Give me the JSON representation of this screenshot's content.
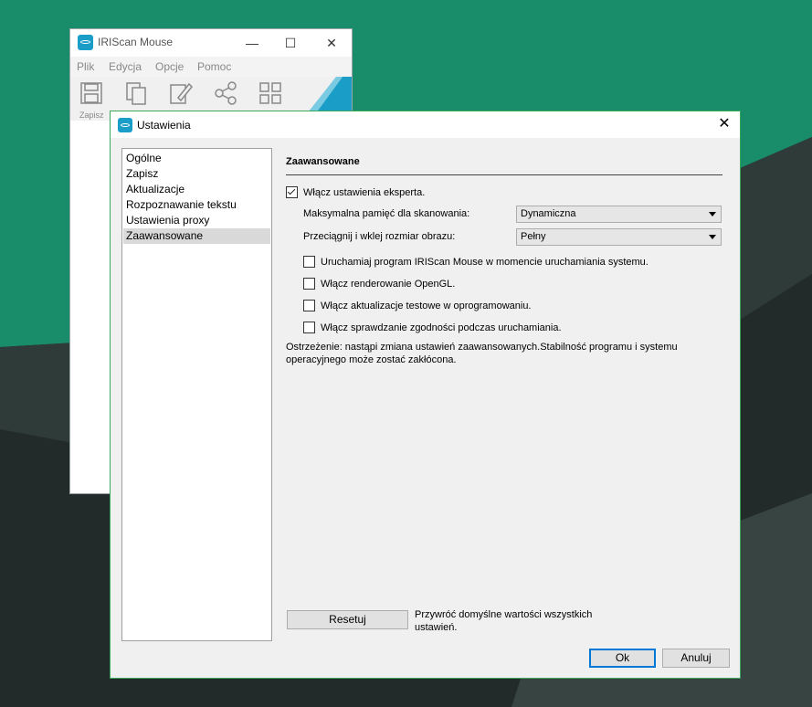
{
  "colors": {
    "desktop_teal": "#198c6a",
    "desktop_dark": "#27302f",
    "accent_blue": "#1a9ec8",
    "dialog_border": "#3aa85a"
  },
  "app_window": {
    "title": "IRIScan Mouse",
    "controls": {
      "minimize": "—",
      "maximize": "☐",
      "close": "✕"
    },
    "menu": [
      "Plik",
      "Edycja",
      "Opcje",
      "Pomoc"
    ],
    "toolbar": {
      "save_label": "Zapisz",
      "icons": [
        "save-icon",
        "copy-icon",
        "edit-icon",
        "share-icon",
        "grid-icon"
      ]
    }
  },
  "dialog": {
    "title": "Ustawienia",
    "close": "✕",
    "nav": [
      "Ogólne",
      "Zapisz",
      "Aktualizacje",
      "Rozpoznawanie tekstu",
      "Ustawienia proxy",
      "Zaawansowane"
    ],
    "selected_nav": "Zaawansowane",
    "section_title": "Zaawansowane",
    "expert_checkbox": {
      "label": "Włącz ustawienia eksperta.",
      "checked": true
    },
    "max_memory": {
      "label": "Maksymalna pamięć dla skanowania:",
      "value": "Dynamiczna"
    },
    "drag_size": {
      "label": "Przeciągnij i wklej rozmiar obrazu:",
      "value": "Pełny"
    },
    "options": [
      {
        "label": "Uruchamiaj program IRIScan Mouse w momencie uruchamiania systemu.",
        "checked": false
      },
      {
        "label": "Włącz renderowanie OpenGL.",
        "checked": false
      },
      {
        "label": "Włącz aktualizacje testowe w oprogramowaniu.",
        "checked": false
      },
      {
        "label": "Włącz sprawdzanie zgodności podczas uruchamiania.",
        "checked": false
      }
    ],
    "warning": "Ostrzeżenie: nastąpi zmiana ustawień zaawansowanych.Stabilność programu i systemu operacyjnego może zostać zakłócona.",
    "reset_button": "Resetuj",
    "reset_description": "Przywróć domyślne wartości wszystkich ustawień.",
    "ok_button": "Ok",
    "cancel_button": "Anuluj"
  }
}
